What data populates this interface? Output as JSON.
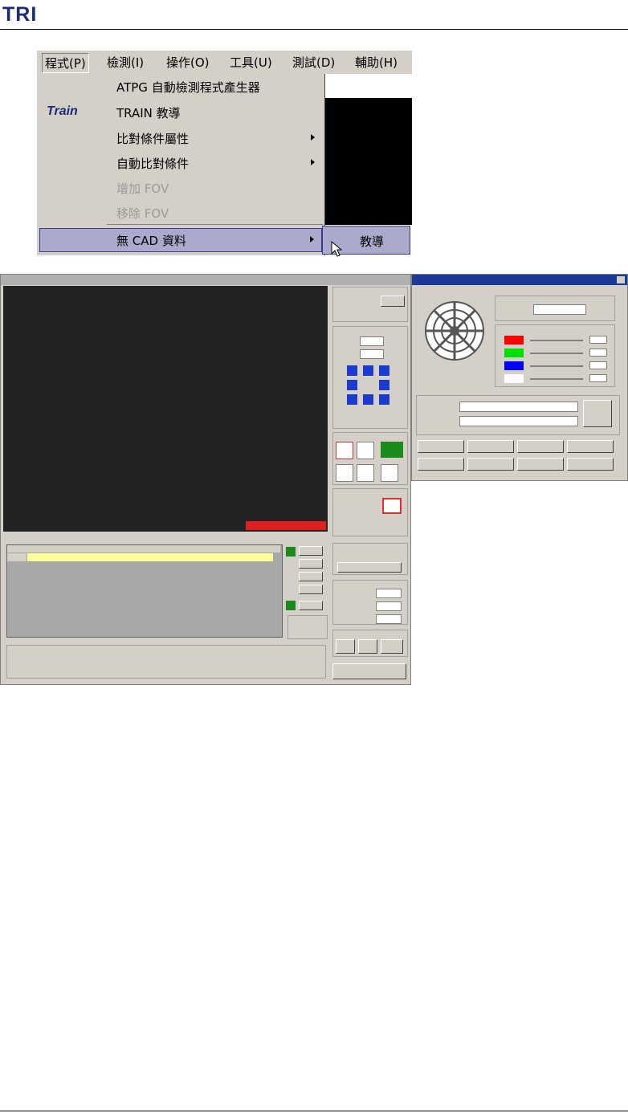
{
  "header": {
    "logo_text": "TRI"
  },
  "menu": {
    "bar": [
      "程式(P)",
      "檢測(I)",
      "操作(O)",
      "工具(U)",
      "測試(D)",
      "輔助(H)"
    ],
    "side_label": "Train",
    "dropdown": {
      "items": [
        "ATPG 自動檢測程式產生器",
        "TRAIN 教導",
        "比對條件屬性",
        "自動比對條件",
        "增加 FOV",
        "移除 FOV"
      ],
      "highlighted": "無 CAD 資料"
    },
    "submenu": {
      "item": "教導"
    }
  },
  "colors": {
    "menu_bg": "#d4d0c8",
    "highlight": "#aaaacc",
    "logo": "#1c2a78",
    "title_blue": "#1a3a9a"
  },
  "icons": [
    "mouse-cursor-icon",
    "arrow-icon",
    "light-ring-icon"
  ]
}
